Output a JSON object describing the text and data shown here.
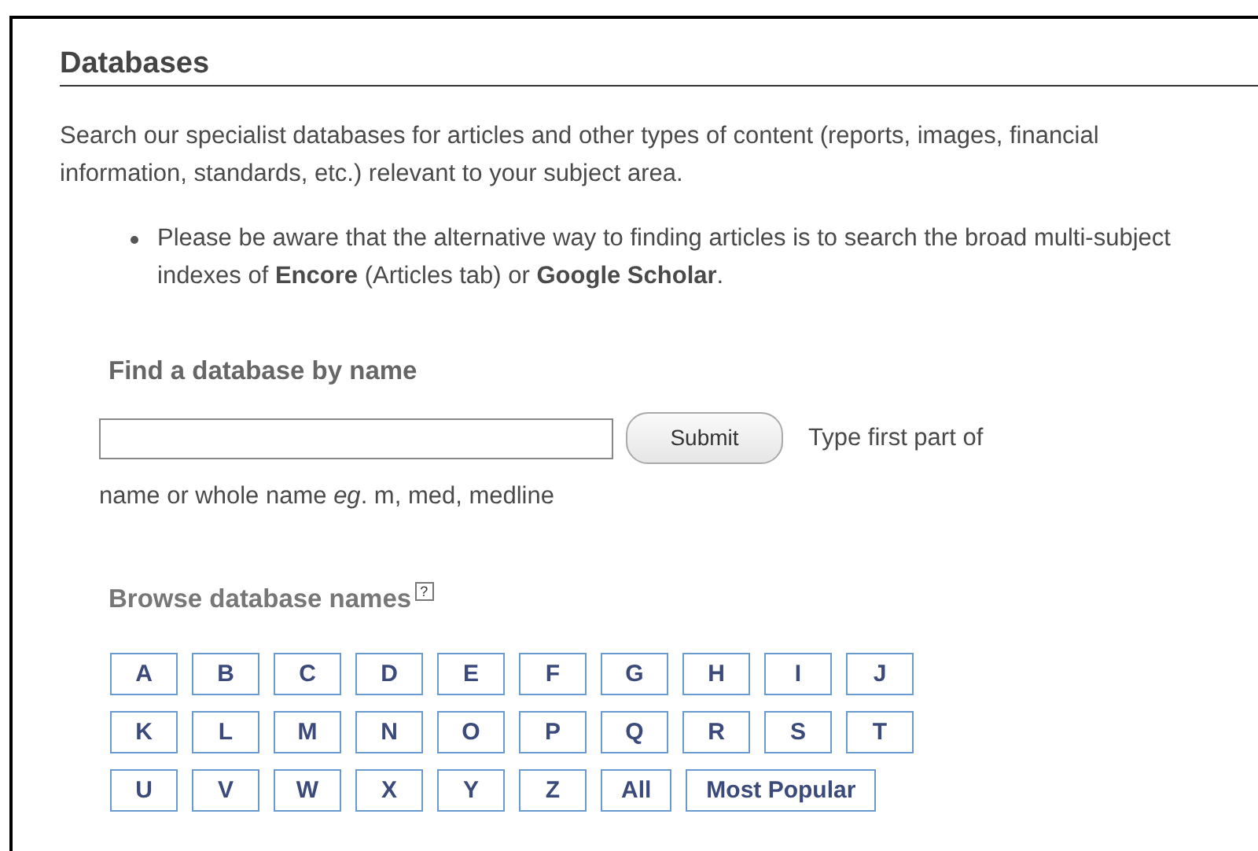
{
  "heading": "Databases",
  "intro": "Search our specialist databases for articles and other types of content (reports, images, financial information, standards, etc.) relevant to your subject area.",
  "bullets": [
    "Please be aware that the alternative way to finding articles is to search the broad multi-subject indexes of **Encore** (Articles tab) or **Google Scholar**."
  ],
  "find": {
    "title": "Find a database by name",
    "button": "Submit",
    "hint_start": "Type first part of",
    "hint_rest": "name or whole name *eg*. m, med, medline"
  },
  "browse": {
    "title": "Browse database names",
    "help": "?",
    "rows": [
      [
        "A",
        "B",
        "C",
        "D",
        "E",
        "F",
        "G",
        "H",
        "I",
        "J"
      ],
      [
        "K",
        "L",
        "M",
        "N",
        "O",
        "P",
        "Q",
        "R",
        "S",
        "T"
      ],
      [
        "U",
        "V",
        "W",
        "X",
        "Y",
        "Z",
        "All",
        "Most Popular"
      ]
    ]
  }
}
